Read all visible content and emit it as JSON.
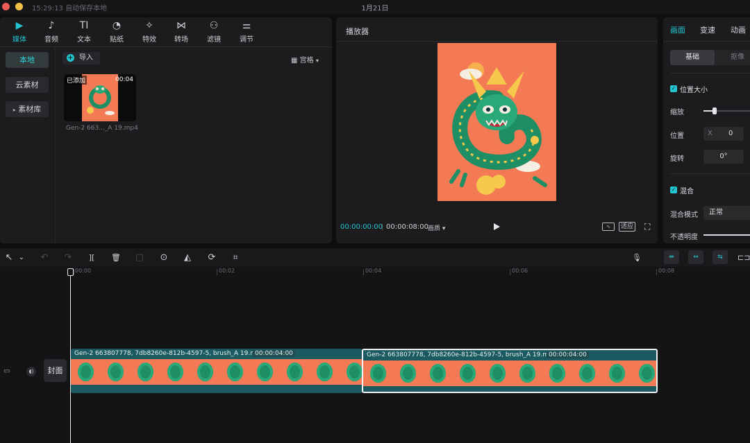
{
  "titlebar": {
    "status": "15:29:13 自动保存本地",
    "center_title": "1月21日"
  },
  "media_toolbar": [
    {
      "label": "媒体",
      "icon": "media-icon",
      "glyph": "▶"
    },
    {
      "label": "音频",
      "icon": "audio-icon",
      "glyph": "♪"
    },
    {
      "label": "文本",
      "icon": "text-icon",
      "glyph": "TI"
    },
    {
      "label": "贴纸",
      "icon": "sticker-icon",
      "glyph": "◔"
    },
    {
      "label": "特效",
      "icon": "effects-icon",
      "glyph": "✧"
    },
    {
      "label": "转场",
      "icon": "transition-icon",
      "glyph": "⋈"
    },
    {
      "label": "滤镜",
      "icon": "filter-icon",
      "glyph": "⚇"
    },
    {
      "label": "调节",
      "icon": "adjust-icon",
      "glyph": "⚌"
    }
  ],
  "media_sidebar": {
    "local": "本地",
    "cloud": "云素材",
    "library": "素材库",
    "library_arrow": "▸"
  },
  "media": {
    "import_label": "导入",
    "view_label": "宫格",
    "view_icon": "▦",
    "view_caret": "▾",
    "thumb_badge": "已添加",
    "thumb_duration": "00:04",
    "thumb_name": "Gen-2 663..._A 19.mp4"
  },
  "player": {
    "title": "播放器",
    "time_current": "00:00:00:00",
    "time_separator": "|",
    "time_total": "00:00:08:00",
    "quality_label": "画质 ▾",
    "fit_label": "适应",
    "fullscreen_glyph": "⛶",
    "wave_glyph": "∿"
  },
  "props": {
    "tabs": [
      "画面",
      "变速",
      "动画"
    ],
    "seg_basic": "基础",
    "seg_cutout": "抠像",
    "position_size": "位置大小",
    "scale_label": "缩放",
    "scale_level": 0.2,
    "position_label": "位置",
    "position_x_label": "X",
    "position_x": "0",
    "rotate_label": "旋转",
    "rotate_value": "0°",
    "blend_label": "混合",
    "blend_mode_label": "混合模式",
    "blend_mode_value": "正常",
    "opacity_label": "不透明度"
  },
  "timeline_toolbar": {
    "select_glyph": "↖",
    "select_caret": "⌄",
    "undo_glyph": "↶",
    "redo_glyph": "↷",
    "split_glyph": "][",
    "delete_glyph": "🗑",
    "freeze_glyph": "▢",
    "play_around_glyph": "⊙",
    "mirror_glyph": "◭",
    "rotate_glyph": "⟳",
    "crop_glyph": "⌗",
    "mic_glyph": "🎙",
    "link_glyph": "⇹",
    "snap_glyph": "⇔",
    "magnet_glyph": "⇆",
    "split_view_glyph": "⊏⊐"
  },
  "ruler": [
    "00:00",
    "00:02",
    "00:04",
    "00:06",
    "00:08"
  ],
  "track": {
    "cover_label": "封面",
    "video_icon_glyph": "▭",
    "audio_icon_glyph": "◖)"
  },
  "clips": [
    {
      "title": "Gen-2 663807778, 7db8260e-812b-4597-5, brush_A 19.mp4",
      "duration": "00:00:04:00"
    },
    {
      "title": "Gen-2 663807778, 7db8260e-812b-4597-5, brush_A 19.mp4",
      "duration": "00:00:04:00"
    }
  ],
  "colors": {
    "accent": "#22c5cf",
    "clip_bg": "#1b5a60",
    "art_orange": "#f37a54",
    "dragon_green": "#1e8e64"
  }
}
